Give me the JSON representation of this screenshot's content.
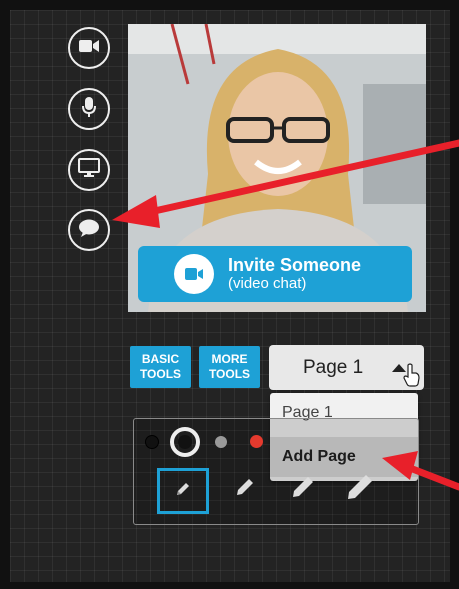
{
  "side_buttons": [
    {
      "name": "video-camera-icon"
    },
    {
      "name": "microphone-icon"
    },
    {
      "name": "screen-share-icon"
    },
    {
      "name": "chat-bubble-icon"
    }
  ],
  "video": {
    "invite_title": "Invite Someone",
    "invite_subtitle": "(video chat)",
    "invite_icon": "video-camera-icon"
  },
  "tools": {
    "basic_label": "BASIC TOOLS",
    "more_label": "MORE TOOLS"
  },
  "page_selector": {
    "current": "Page 1",
    "options": [
      "Page 1",
      "Add Page"
    ],
    "highlighted_option": "Add Page"
  },
  "toolbox": {
    "colors": [
      "#111111",
      "#ffffff",
      "#9a9a9a",
      "#e53a2e"
    ],
    "selected_pencil_index": 0,
    "accent": "#1ea1d6"
  },
  "annotation_color": "#e8202a"
}
